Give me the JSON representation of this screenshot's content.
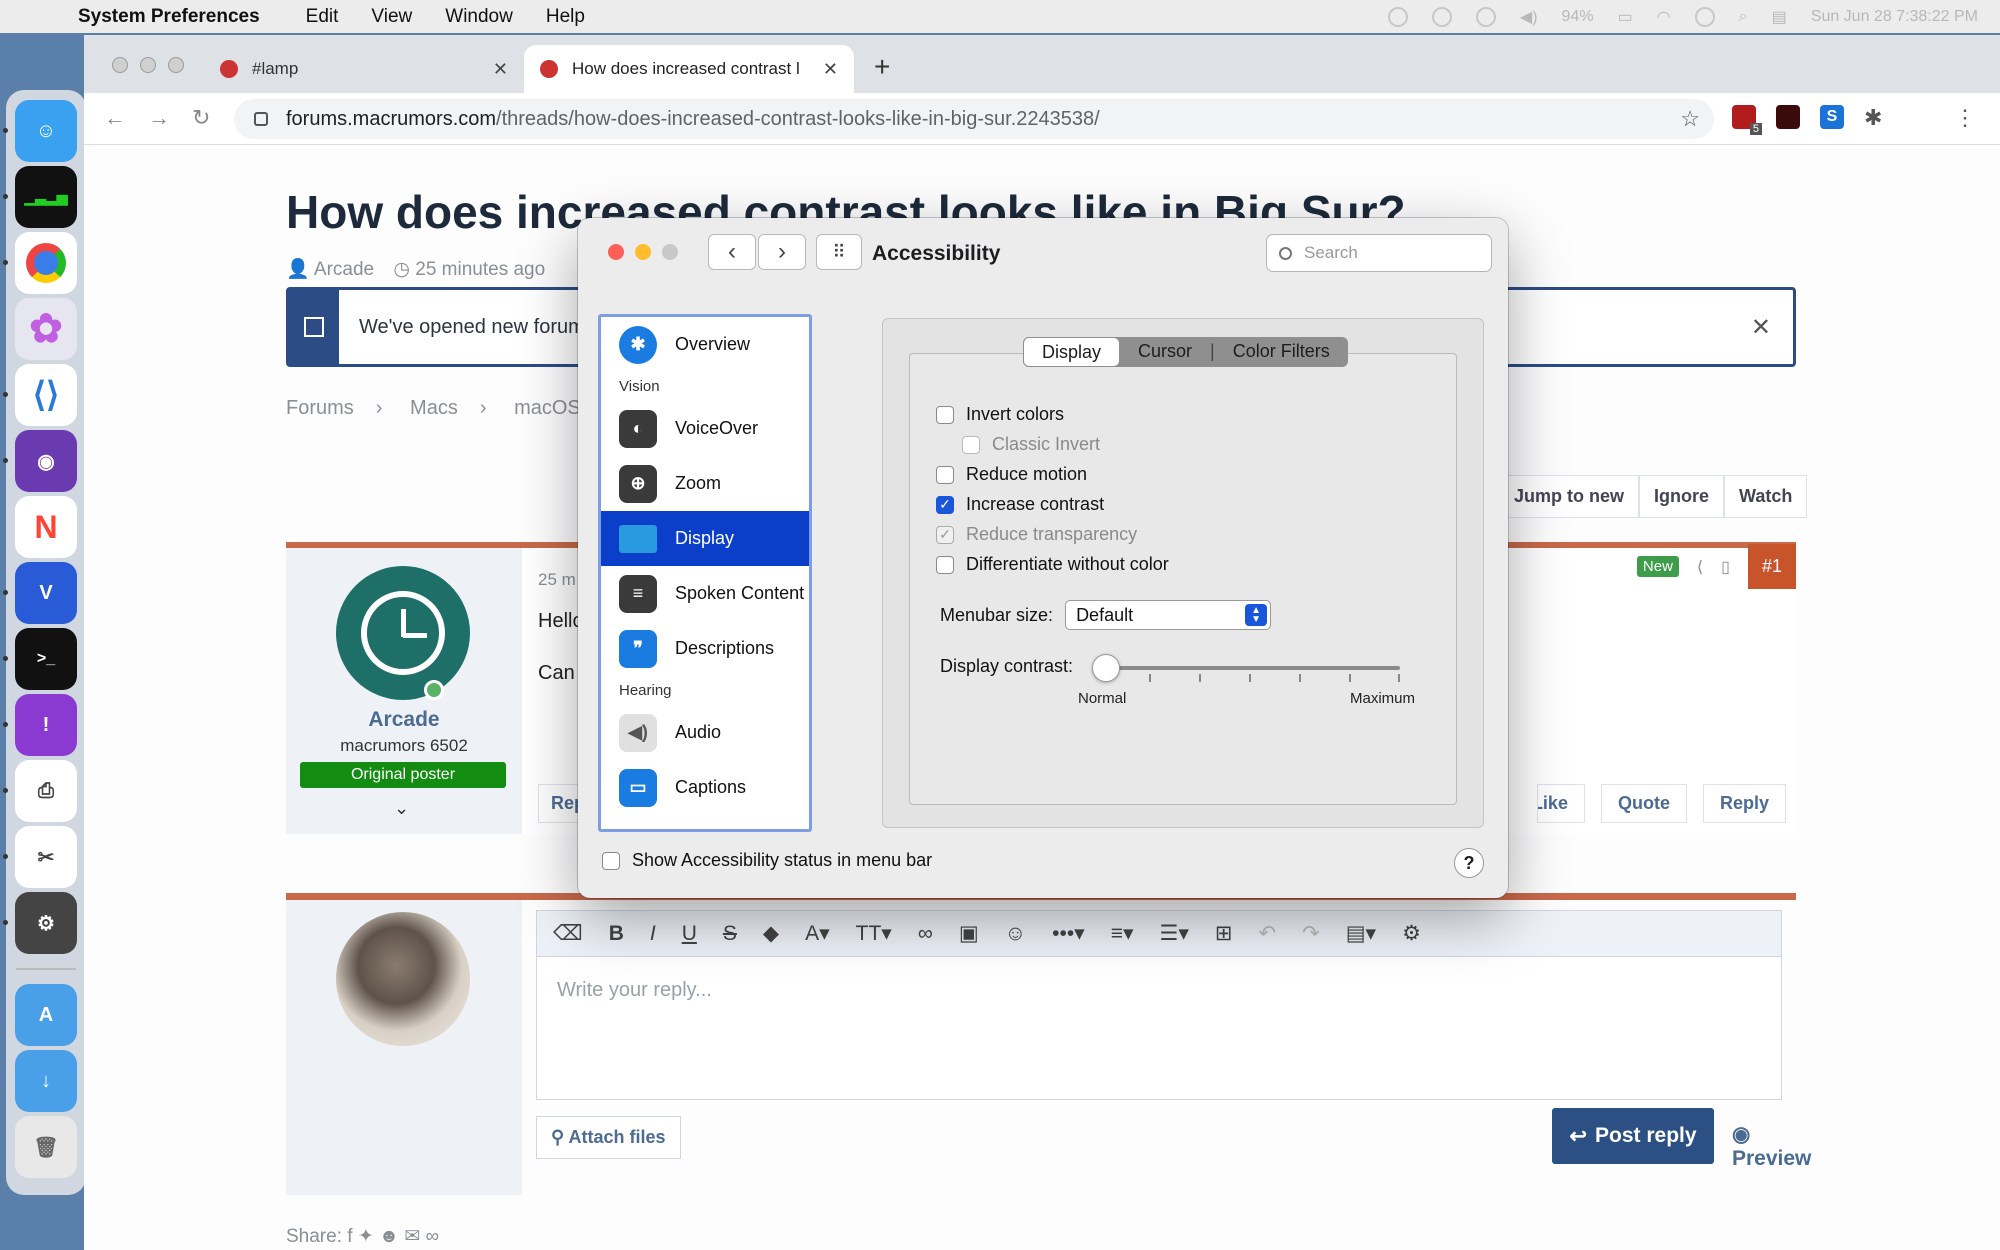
{
  "menubar": {
    "app": "System Preferences",
    "items": [
      "Edit",
      "View",
      "Window",
      "Help"
    ],
    "battery": "94%",
    "clock": "Sun Jun 28  7:38:22 PM"
  },
  "browser": {
    "tabs": [
      {
        "title": "#lamp"
      },
      {
        "title": "How does increased contrast l"
      }
    ],
    "url_domain": "forums.macrumors.com",
    "url_path": "/threads/how-does-increased-contrast-looks-like-in-big-sur.2243538/",
    "extension_badge": "5"
  },
  "page": {
    "title": "How does increased contrast looks like in Big Sur?",
    "author": "Arcade",
    "time": "25 minutes ago",
    "notice": "We've opened new forums",
    "breadcrumbs": [
      "Forums",
      "Macs",
      "macOS"
    ],
    "thread_actions": [
      "Jump to new",
      "Ignore",
      "Watch"
    ],
    "post": {
      "username": "Arcade",
      "user_title": "macrumors 6502",
      "badge": "Original poster",
      "time": "25 m",
      "line1": "Hello",
      "line2": "Can",
      "new_badge": "New",
      "number": "#1",
      "buttons": [
        "Report",
        "Like",
        "Quote",
        "Reply"
      ]
    },
    "reply": {
      "placeholder": "Write your reply...",
      "attach": "Attach files",
      "post_reply": "Post reply",
      "preview": "Preview"
    },
    "share_label": "Share:"
  },
  "prefs": {
    "title": "Accessibility",
    "search_placeholder": "Search",
    "sidebar": {
      "overview": "Overview",
      "section_vision": "Vision",
      "voiceover": "VoiceOver",
      "zoom": "Zoom",
      "display": "Display",
      "spoken": "Spoken Content",
      "descriptions": "Descriptions",
      "section_hearing": "Hearing",
      "audio": "Audio",
      "captions": "Captions"
    },
    "tabs": {
      "display": "Display",
      "cursor": "Cursor",
      "filters": "Color Filters"
    },
    "options": {
      "invert": "Invert colors",
      "classic": "Classic Invert",
      "motion": "Reduce motion",
      "contrast": "Increase contrast",
      "transparency": "Reduce transparency",
      "differentiate": "Differentiate without color"
    },
    "checked": {
      "invert": false,
      "classic": false,
      "motion": false,
      "contrast": true,
      "transparency": true,
      "differentiate": false
    },
    "menubar_label": "Menubar size:",
    "menubar_value": "Default",
    "contrast_label": "Display contrast:",
    "contrast_min": "Normal",
    "contrast_max": "Maximum",
    "contrast_level": 0,
    "status_label": "Show Accessibility status in menu bar",
    "help": "?"
  },
  "colors": {
    "selection": "#0c3fc9",
    "checkbox_on": "#1a56d9",
    "forum_accent": "#c8694a",
    "forum_blue": "#2c4c86"
  }
}
